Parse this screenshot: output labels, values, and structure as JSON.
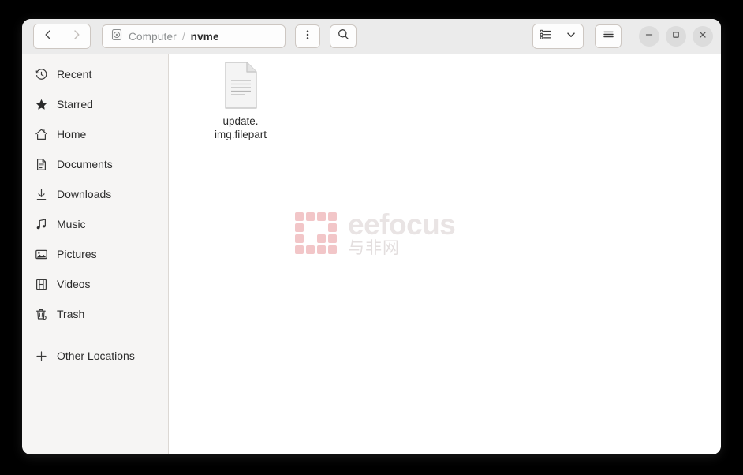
{
  "window": {
    "controls": {
      "minimize": "minimize-icon",
      "maximize": "maximize-icon",
      "close": "close-icon"
    }
  },
  "header": {
    "back_icon": "chevron-left-icon",
    "forward_icon": "chevron-right-icon",
    "location_icon": "drive-icon",
    "breadcrumb": {
      "root": "Computer",
      "separator": "/",
      "current": "nvme"
    },
    "menu_dots_icon": "more-options-icon",
    "search_icon": "search-icon",
    "view_list_icon": "list-view-icon",
    "view_dropdown_icon": "chevron-down-icon",
    "hamburger_icon": "hamburger-menu-icon"
  },
  "sidebar": {
    "items": [
      {
        "label": "Recent",
        "icon": "clock-icon"
      },
      {
        "label": "Starred",
        "icon": "star-icon"
      },
      {
        "label": "Home",
        "icon": "home-icon"
      },
      {
        "label": "Documents",
        "icon": "document-icon"
      },
      {
        "label": "Downloads",
        "icon": "download-icon"
      },
      {
        "label": "Music",
        "icon": "music-note-icon"
      },
      {
        "label": "Pictures",
        "icon": "picture-icon"
      },
      {
        "label": "Videos",
        "icon": "video-film-icon"
      },
      {
        "label": "Trash",
        "icon": "trash-icon"
      }
    ],
    "other_locations": {
      "label": "Other Locations",
      "icon": "plus-icon"
    }
  },
  "content": {
    "files": [
      {
        "name": "update.img.filepart",
        "line1": "update.",
        "line2": "img.filepart",
        "icon": "text-file-icon"
      }
    ]
  },
  "watermark": {
    "title": "eefocus",
    "subtitle": "与非网",
    "color": "#f2c6c8",
    "grid": [
      [
        1,
        1,
        1,
        1
      ],
      [
        1,
        0,
        0,
        1
      ],
      [
        1,
        0,
        1,
        1
      ],
      [
        1,
        1,
        1,
        1
      ]
    ]
  },
  "colors": {
    "header_bg": "#ebebeb",
    "sidebar_bg": "#f6f5f4",
    "content_bg": "#ffffff",
    "desktop_bg": "#000000"
  }
}
